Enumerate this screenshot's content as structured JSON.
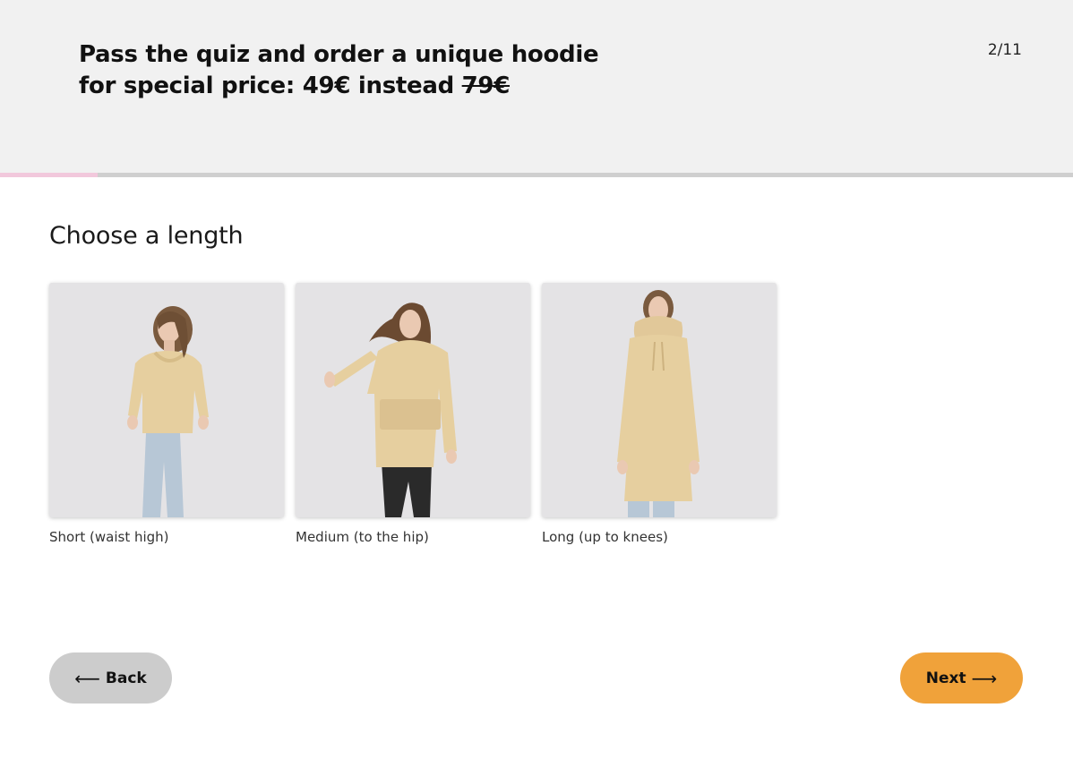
{
  "header": {
    "title_line1": "Pass the quiz and order a unique hoodie",
    "title_line2_prefix": "for special price: 49€ instead ",
    "old_price": "79€",
    "step_counter": "2/11"
  },
  "progress": {
    "current_step": 2,
    "total_steps": 11,
    "fill_color": "#f2c8dc"
  },
  "question": {
    "title": "Choose a length"
  },
  "options": [
    {
      "label": "Short (waist high)",
      "image": "model in cropped beige hoodie and jeans"
    },
    {
      "label": "Medium (to the hip)",
      "image": "model in hip-length beige hoodie with front pocket"
    },
    {
      "label": "Long (up to knees)",
      "image": "model in knee-length beige hoodie dress"
    }
  ],
  "navigation": {
    "back_label": "Back",
    "back_icon": "arrow-left-icon",
    "next_label": "Next",
    "next_icon": "arrow-right-icon",
    "next_color": "#f0a23a",
    "back_color": "#cccccc"
  }
}
